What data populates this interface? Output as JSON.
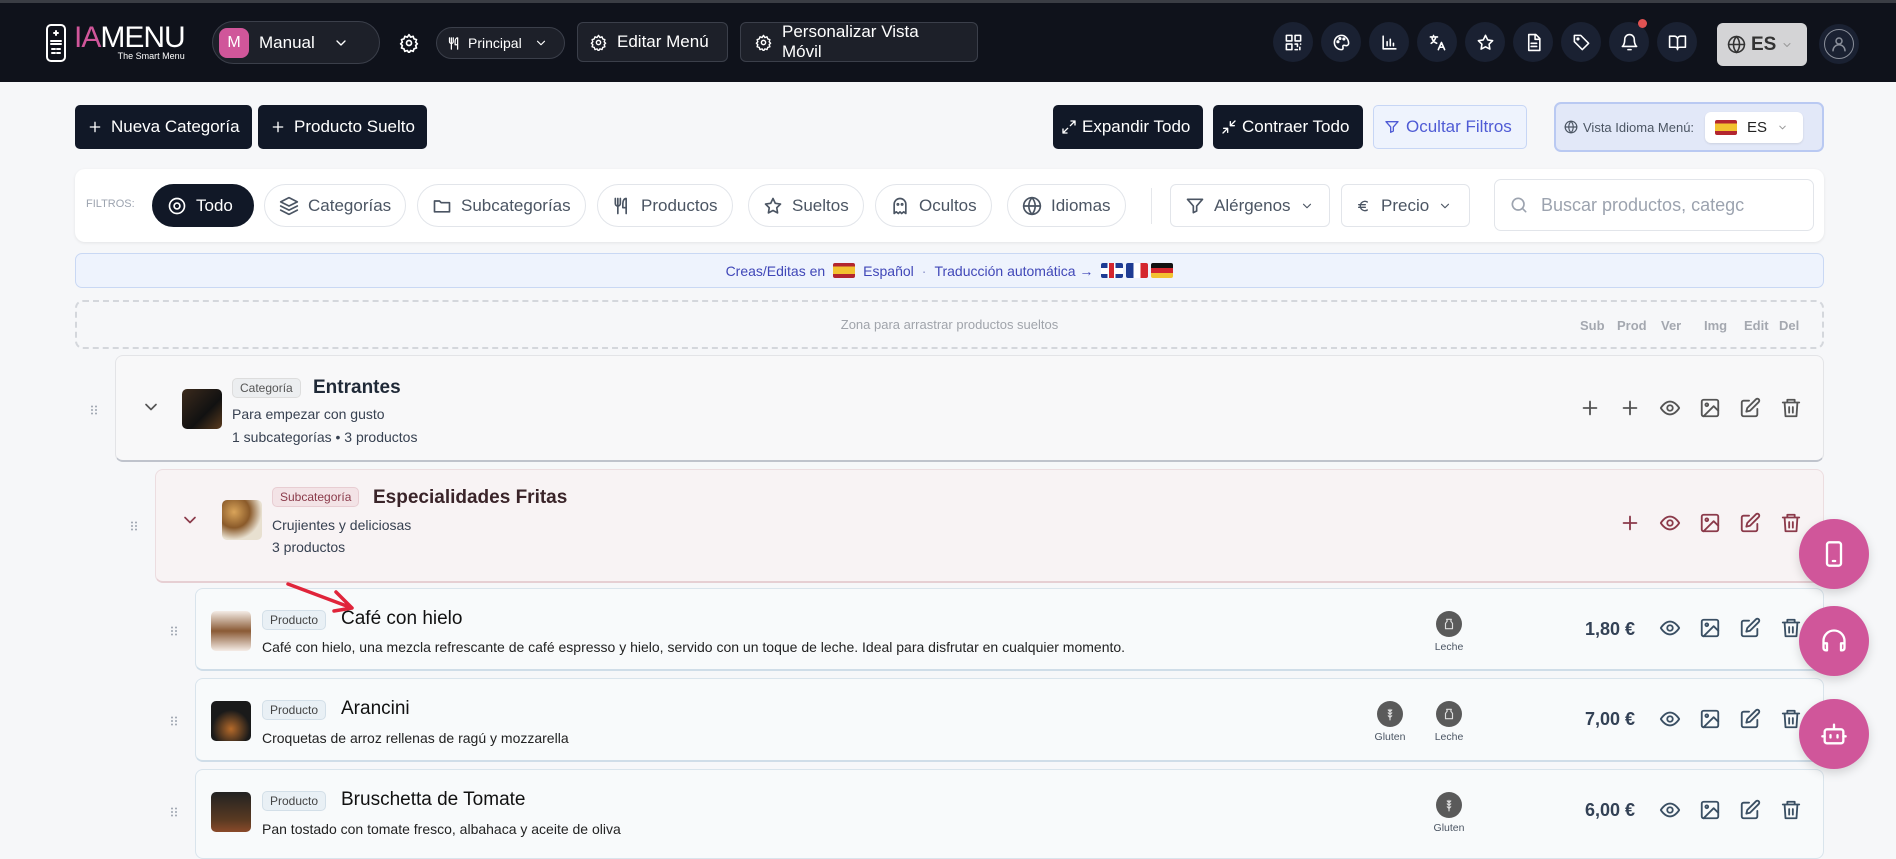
{
  "header": {
    "logo_text_ia": "IA",
    "logo_text_menu": "MENU",
    "logo_tagline": "The Smart Menu",
    "menu_selector": {
      "avatar_letter": "M",
      "label": "Manual"
    },
    "menu_type": "Principal",
    "edit_menu": "Editar Menú",
    "customize_mobile": "Personalizar Vista Móvil",
    "language": "ES",
    "notification_dot": true
  },
  "toolbar": {
    "new_category": "Nueva Categoría",
    "loose_product": "Producto Suelto",
    "expand_all": "Expandir Todo",
    "collapse_all": "Contraer Todo",
    "hide_filters": "Ocultar Filtros",
    "view_language_label": "Vista Idioma Menú:",
    "view_language_value": "ES"
  },
  "filters": {
    "label": "FILTROS:",
    "chips": [
      "Todo",
      "Categorías",
      "Subcategorías",
      "Productos",
      "Sueltos",
      "Ocultos",
      "Idiomas"
    ],
    "active": "Todo",
    "allergens": "Alérgenos",
    "price": "Precio",
    "search_placeholder": "Buscar productos, categc"
  },
  "banner": {
    "prefix": "Creas/Editas en",
    "language": "Español",
    "separator": "·",
    "auto_translation": "Traducción automática →"
  },
  "dropzone": {
    "text": "Zona para arrastrar productos sueltos",
    "columns": [
      "Sub",
      "Prod",
      "Ver",
      "Img",
      "Edit",
      "Del"
    ]
  },
  "category": {
    "badge": "Categoría",
    "name": "Entrantes",
    "description": "Para empezar con gusto",
    "meta": "1 subcategorías • 3 productos"
  },
  "subcategory": {
    "badge": "Subcategoría",
    "name": "Especialidades Fritas",
    "description": "Crujientes y deliciosas",
    "meta": "3 productos"
  },
  "products": [
    {
      "badge": "Producto",
      "name": "Café con hielo",
      "description": "Café con hielo, una mezcla refrescante de café espresso y hielo, servido con un toque de leche. Ideal para disfrutar en cualquier momento.",
      "allergens": [
        "Leche"
      ],
      "price": "1,80 €"
    },
    {
      "badge": "Producto",
      "name": "Arancini",
      "description": "Croquetas de arroz rellenas de ragú y mozzarella",
      "allergens": [
        "Gluten",
        "Leche"
      ],
      "price": "7,00 €"
    },
    {
      "badge": "Producto",
      "name": "Bruschetta de Tomate",
      "description": "Pan tostado con tomate fresco, albahaca y aceite de oliva",
      "allergens": [
        "Gluten"
      ],
      "price": "6,00 €"
    }
  ],
  "colors": {
    "brand": "#d0569a",
    "dark": "#111827",
    "subcategory_accent": "#8b3a4a",
    "annotation_arrow": "#e0243a"
  }
}
